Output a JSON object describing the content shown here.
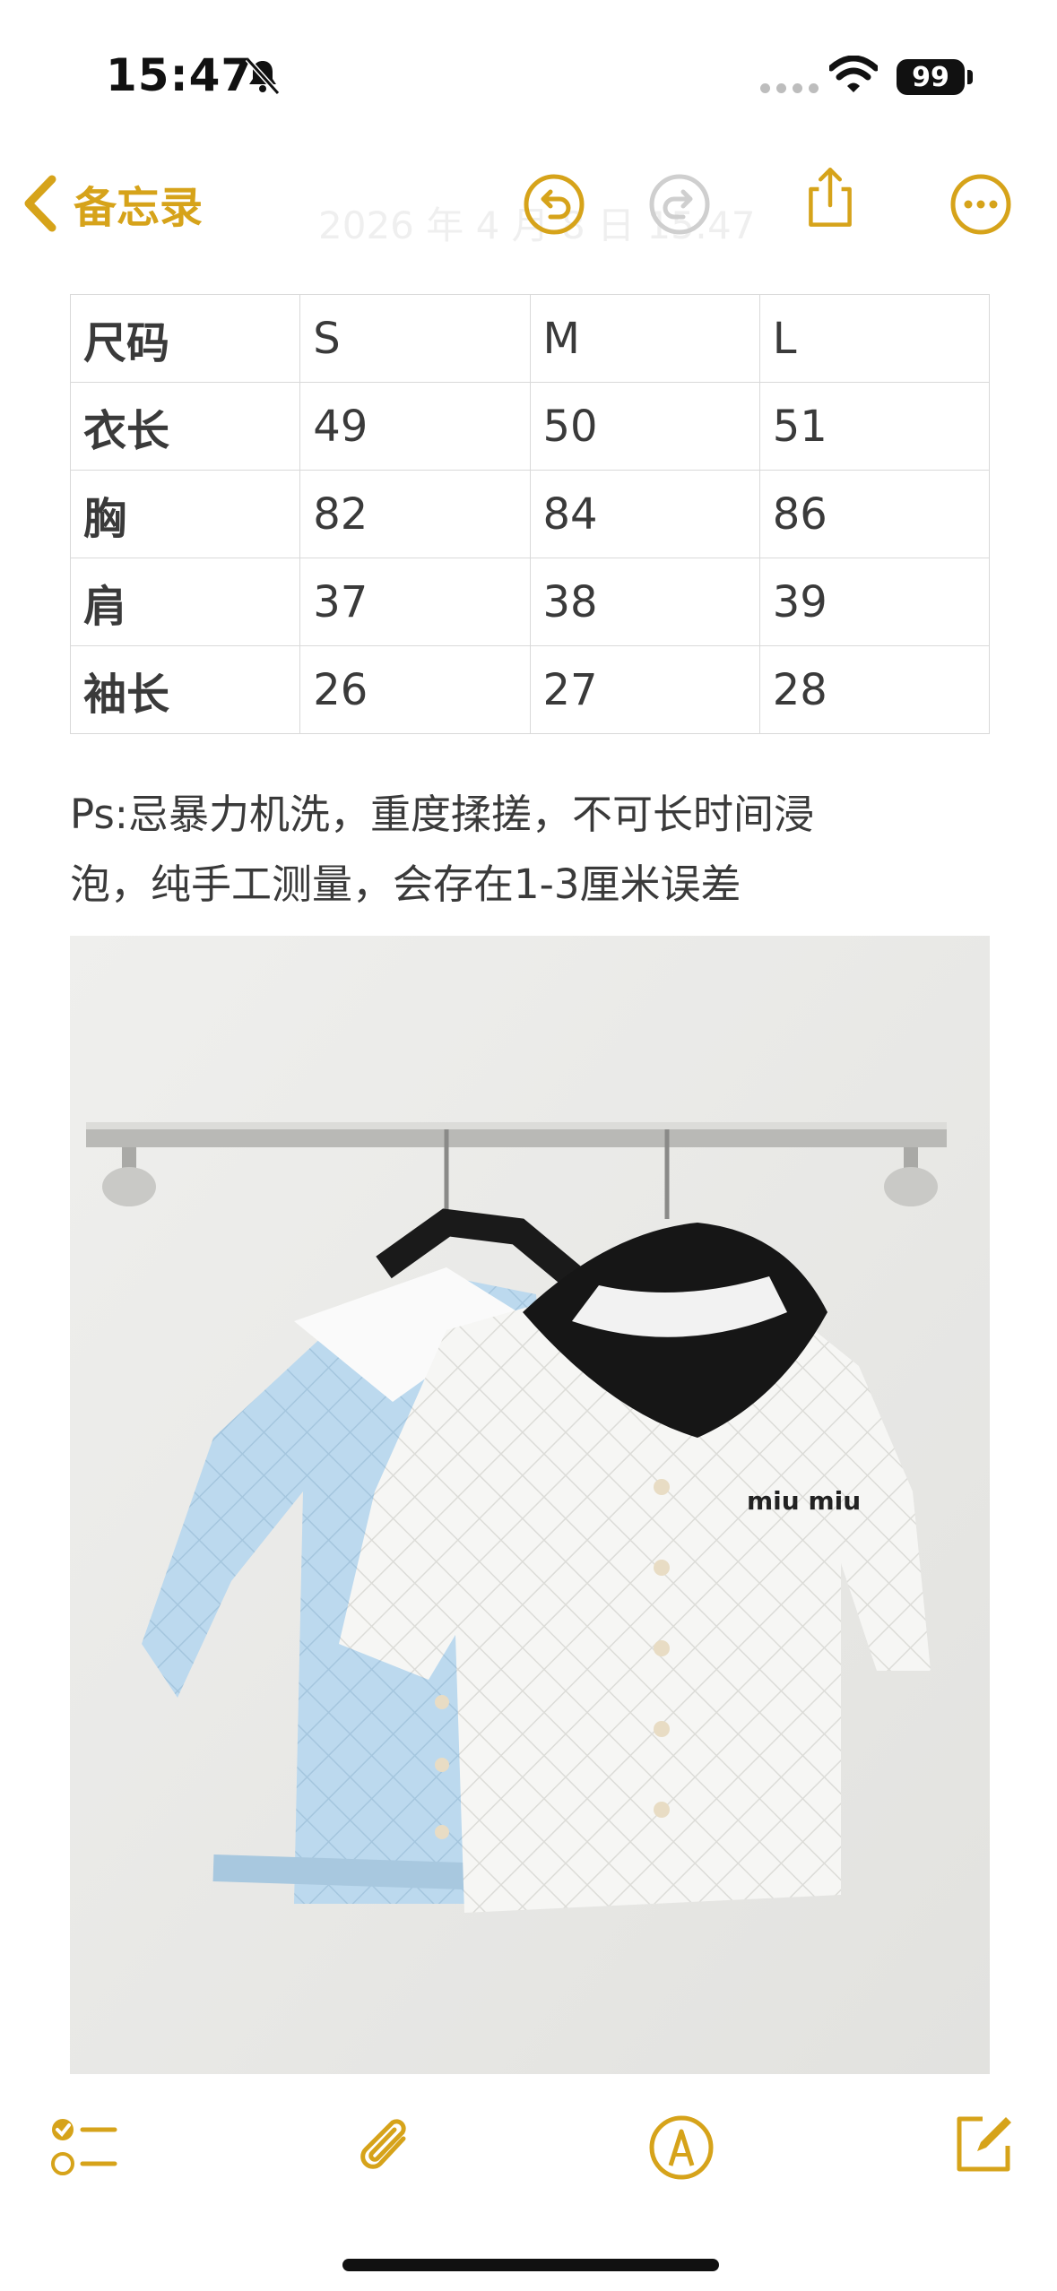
{
  "status_bar": {
    "time": "15:47",
    "battery": "99",
    "icons": [
      "bell-slash-icon",
      "signal-icon",
      "wifi-icon",
      "battery-icon"
    ]
  },
  "nav": {
    "back_label": "备忘录",
    "date_faded": "2026 年 4 月 8 日 15:47",
    "icons": [
      "chevron-left-icon",
      "undo-icon",
      "redo-icon",
      "share-icon",
      "more-icon"
    ]
  },
  "size_table": {
    "rows": [
      [
        "尺码",
        "S",
        "M",
        "L"
      ],
      [
        "衣长",
        "49",
        "50",
        "51"
      ],
      [
        "胸",
        "82",
        "84",
        "86"
      ],
      [
        "肩",
        "37",
        "38",
        "39"
      ],
      [
        "袖长",
        "26",
        "27",
        "28"
      ]
    ]
  },
  "note": {
    "line1": "Ps:忌暴力机洗，重度揉搓，不可长时间浸",
    "line2": "泡，纯手工测量，会存在1-3厘米误差"
  },
  "photo": {
    "brand_text": "miu miu"
  },
  "toolbar": {
    "icons": [
      "checklist-icon",
      "paperclip-icon",
      "markup-icon",
      "compose-icon"
    ]
  },
  "colors": {
    "accent": "#d6a31a",
    "text": "#3a3a3a",
    "table_border": "#d9d9d9"
  }
}
